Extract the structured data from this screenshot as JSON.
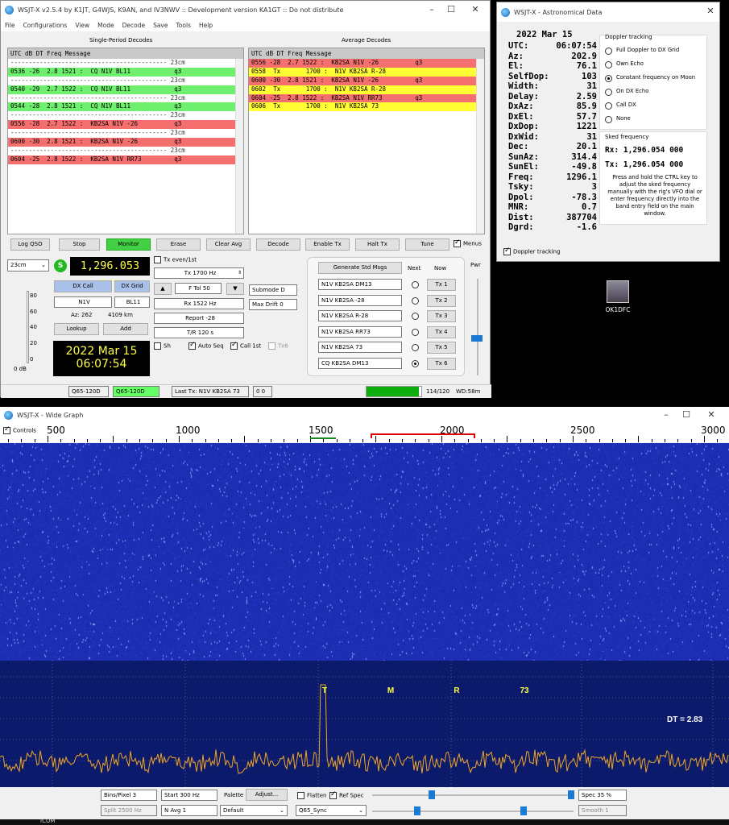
{
  "main": {
    "title": "WSJT-X   v2.5.4   by K1JT, G4WJS, K9AN, and IV3NWV :: Development version KA1GT :: Do not distribute",
    "menu": [
      "File",
      "Configurations",
      "View",
      "Mode",
      "Decode",
      "Save",
      "Tools",
      "Help"
    ],
    "single_period_title": "Single-Period Decodes",
    "average_title": "Average Decodes",
    "header": "UTC   dB   DT Freq    Message",
    "single_rows": [
      {
        "text": "------------------------------------------- 23cm",
        "cls": "sep"
      },
      {
        "text": "0536 -26  2.8 1521 :  CQ N1V BL11            q3",
        "cls": "g"
      },
      {
        "text": "------------------------------------------- 23cm",
        "cls": "sep"
      },
      {
        "text": "0540 -29  2.7 1522 :  CQ N1V BL11            q3",
        "cls": "g"
      },
      {
        "text": "------------------------------------------- 23cm",
        "cls": "sep"
      },
      {
        "text": "0544 -28  2.8 1521 :  CQ N1V BL11            q3",
        "cls": "g"
      },
      {
        "text": "------------------------------------------- 23cm",
        "cls": "sep"
      },
      {
        "text": "0556 -28  2.7 1522 :  KB2SA N1V -26          q3",
        "cls": "r"
      },
      {
        "text": "------------------------------------------- 23cm",
        "cls": "sep"
      },
      {
        "text": "0600 -30  2.8 1521 :  KB2SA N1V -26          q3",
        "cls": "r"
      },
      {
        "text": "------------------------------------------- 23cm",
        "cls": "sep"
      },
      {
        "text": "0604 -25  2.8 1522 :  KB2SA N1V RR73         q3",
        "cls": "r"
      }
    ],
    "average_rows": [
      {
        "text": "0556 -28  2.7 1522 :  KB2SA N1V -26          q3",
        "cls": "r"
      },
      {
        "text": "0558  Tx       1700 :  N1V KB2SA R-28",
        "cls": "y"
      },
      {
        "text": "0600 -30  2.8 1521 :  KB2SA N1V -26          q3",
        "cls": "r"
      },
      {
        "text": "0602  Tx       1700 :  N1V KB2SA R-28",
        "cls": "y"
      },
      {
        "text": "0604 -25  2.8 1522 :  KB2SA N1V RR73         q3",
        "cls": "r"
      },
      {
        "text": "0606  Tx       1700 :  N1V KB2SA 73",
        "cls": "y"
      }
    ],
    "buttons": {
      "log_qso": "Log QSO",
      "stop": "Stop",
      "monitor": "Monitor",
      "erase": "Erase",
      "clear_avg": "Clear Avg",
      "decode": "Decode",
      "enable_tx": "Enable Tx",
      "halt_tx": "Halt Tx",
      "tune": "Tune",
      "menus": "Menus"
    },
    "band": "23cm",
    "frequency": "1,296.053 949",
    "s_badge": "S",
    "dx_call_btn": "DX Call",
    "dx_grid_btn": "DX Grid",
    "dx_call": "N1V",
    "dx_grid": "BL11",
    "az": "Az: 262",
    "dist": "4109 km",
    "lookup": "Lookup",
    "add": "Add",
    "date": "2022 Mar 15",
    "time": "06:07:54",
    "meter_ticks": [
      "80",
      "60",
      "40",
      "20",
      "0"
    ],
    "meter_db": "0 dB",
    "tx_even": "Tx even/1st",
    "tx_hz": "Tx  1700  Hz",
    "ftol": "F Tol  50",
    "rx_hz": "Rx  1522  Hz",
    "report": "Report -28",
    "tr": "T/R  120  s",
    "sh": "Sh",
    "auto_seq": "Auto Seq",
    "call_1st": "Call 1st",
    "tx6_chk": "Tx6",
    "submode": "Submode D",
    "max_drift": "Max Drift  0",
    "gen_std": "Generate Std Msgs",
    "next": "Next",
    "now": "Now",
    "pwr": "Pwr",
    "tx_msgs": [
      "N1V KB2SA DM13",
      "N1V KB2SA -28",
      "N1V KB2SA R-28",
      "N1V KB2SA RR73",
      "N1V KB2SA 73",
      "CQ KB2SA DM13"
    ],
    "tx_btns": [
      "Tx 1",
      "Tx 2",
      "Tx 3",
      "Tx 4",
      "Tx 5",
      "Tx 6"
    ],
    "status": {
      "mode1": "Q65-120D",
      "mode2": "Q65-120D",
      "last_tx": "Last Tx: N1V KB2SA 73",
      "counter": "0  0",
      "count": "114/120",
      "wd": "WD:58m"
    }
  },
  "astro": {
    "title": "WSJT-X - Astronomical Data",
    "date": "2022 Mar 15",
    "rows": [
      {
        "k": "UTC:",
        "v": "06:07:54"
      },
      {
        "k": "Az:",
        "v": "202.9"
      },
      {
        "k": "El:",
        "v": "76.1"
      },
      {
        "k": "SelfDop:",
        "v": "103"
      },
      {
        "k": "Width:",
        "v": "31"
      },
      {
        "k": "Delay:",
        "v": "2.59"
      },
      {
        "k": "DxAz:",
        "v": "85.9"
      },
      {
        "k": "DxEl:",
        "v": "57.7"
      },
      {
        "k": "DxDop:",
        "v": "1221"
      },
      {
        "k": "DxWid:",
        "v": "31"
      },
      {
        "k": "Dec:",
        "v": "20.1"
      },
      {
        "k": "SunAz:",
        "v": "314.4"
      },
      {
        "k": "SunEl:",
        "v": "-49.8"
      },
      {
        "k": "Freq:",
        "v": "1296.1"
      },
      {
        "k": "Tsky:",
        "v": "3"
      },
      {
        "k": "Dpol:",
        "v": "-78.3"
      },
      {
        "k": "MNR:",
        "v": "0.7"
      },
      {
        "k": "Dist:",
        "v": "387704"
      },
      {
        "k": "Dgrd:",
        "v": "-1.6"
      }
    ],
    "doppler_title": "Doppler tracking",
    "doppler_opts": [
      "Full Doppler to DX Grid",
      "Own Echo",
      "Constant frequency on Moon",
      "On DX Echo",
      "Call DX",
      "None"
    ],
    "doppler_selected": 2,
    "sked_title": "Sked frequency",
    "rx": "Rx: 1,296.054 000",
    "tx": "Tx: 1,296.054 000",
    "sked_note": "Press and hold the CTRL key to adjust the sked frequency manually with the rig's VFO dial or enter frequency directly into the band entry field on the main window.",
    "doppler_chk": "Doppler tracking"
  },
  "desktop": {
    "icon_label": "OK1DFC",
    "taskbar": "ICOM"
  },
  "wide": {
    "title": "WSJT-X - Wide Graph",
    "controls": "Controls",
    "ticks": [
      "500",
      "1000",
      "1500",
      "2000",
      "2500",
      "3000"
    ],
    "markers": [
      "T",
      "M",
      "R",
      "73"
    ],
    "dt": "DT =  2.83",
    "bins": "Bins/Pixel  3",
    "start": "Start  300 Hz",
    "palette": "Palette",
    "adjust": "Adjust...",
    "flatten": "Flatten",
    "ref_spec": "Ref Spec",
    "spec": "Spec  35 %",
    "split": "Split  2500  Hz",
    "navg": "N Avg  1",
    "default": "Default",
    "q65sync": "Q65_Sync",
    "smooth": "Smooth  1"
  }
}
